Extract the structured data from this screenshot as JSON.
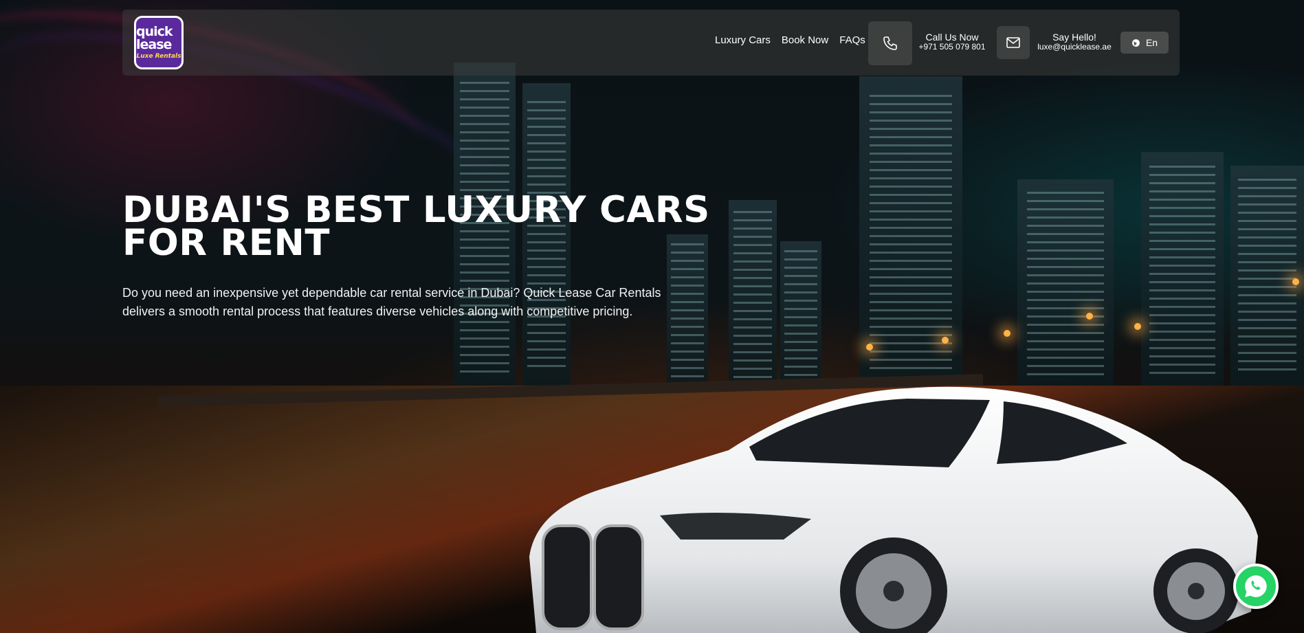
{
  "brand": {
    "logo_line1": "quick lease",
    "logo_line2": "Luxe Rentals"
  },
  "nav": {
    "links": [
      "Luxury Cars",
      "Book Now",
      "FAQs"
    ]
  },
  "contact": {
    "call_title": "Call Us Now",
    "call_number": "+971 505 079 801",
    "email_title": "Say Hello!",
    "email_address": "luxe@quicklease.ae"
  },
  "language": {
    "label": "En"
  },
  "hero": {
    "headline_line1": "DUBAI'S BEST LUXURY CARS",
    "headline_line2": "FOR RENT",
    "description": "Do you need an inexpensive yet dependable car rental service in Dubai? Quick Lease Car Rentals delivers a smooth rental process that features diverse vehicles along with competitive pricing."
  },
  "icons": {
    "phone": "phone-icon",
    "mail": "mail-icon",
    "globe": "globe-icon",
    "whatsapp": "whatsapp-icon"
  },
  "colors": {
    "brand_purple": "#5a2a9c",
    "whatsapp_green": "#25d366"
  }
}
